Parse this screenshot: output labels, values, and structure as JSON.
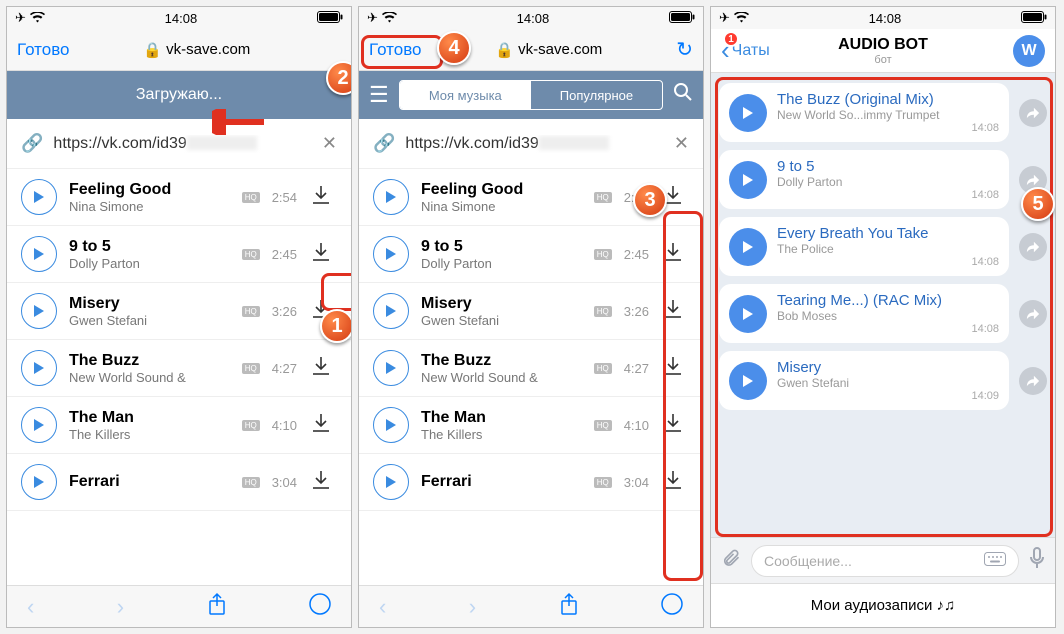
{
  "status_time": "14:08",
  "p1": {
    "done": "Готово",
    "domain": "vk-save.com",
    "loading": "Загружаю...",
    "url_prefix": "https://vk.com/id39"
  },
  "p2": {
    "done": "Готово",
    "domain": "vk-save.com",
    "tab1": "Моя музыка",
    "tab2": "Популярное",
    "url_prefix": "https://vk.com/id39"
  },
  "tracks": [
    {
      "title": "Feeling Good",
      "artist": "Nina Simone",
      "dur": "2:54"
    },
    {
      "title": "9 to 5",
      "artist": "Dolly Parton",
      "dur": "2:45"
    },
    {
      "title": "Misery",
      "artist": "Gwen Stefani",
      "dur": "3:26"
    },
    {
      "title": "The Buzz",
      "artist": "New World Sound &",
      "dur": "4:27"
    },
    {
      "title": "The Man",
      "artist": "The Killers",
      "dur": "4:10"
    },
    {
      "title": "Ferrari",
      "artist": "",
      "dur": "3:04"
    }
  ],
  "p3": {
    "back": "Чаты",
    "back_badge": "1",
    "title": "AUDIO BOT",
    "subtitle": "бот",
    "input_placeholder": "Сообщение...",
    "audio_button": "Мои аудиозаписи ♪♫"
  },
  "messages": [
    {
      "title": "The Buzz (Original Mix)",
      "artist": "New World So...immy Trumpet",
      "time": "14:08"
    },
    {
      "title": "9 to 5",
      "artist": "Dolly Parton",
      "time": "14:08"
    },
    {
      "title": "Every Breath You Take",
      "artist": "The Police",
      "time": "14:08"
    },
    {
      "title": "Tearing Me...) (RAC Mix)",
      "artist": "Bob Moses",
      "time": "14:08"
    },
    {
      "title": "Misery",
      "artist": "Gwen Stefani",
      "time": "14:09"
    }
  ],
  "badges": [
    "1",
    "2",
    "3",
    "4",
    "5"
  ]
}
